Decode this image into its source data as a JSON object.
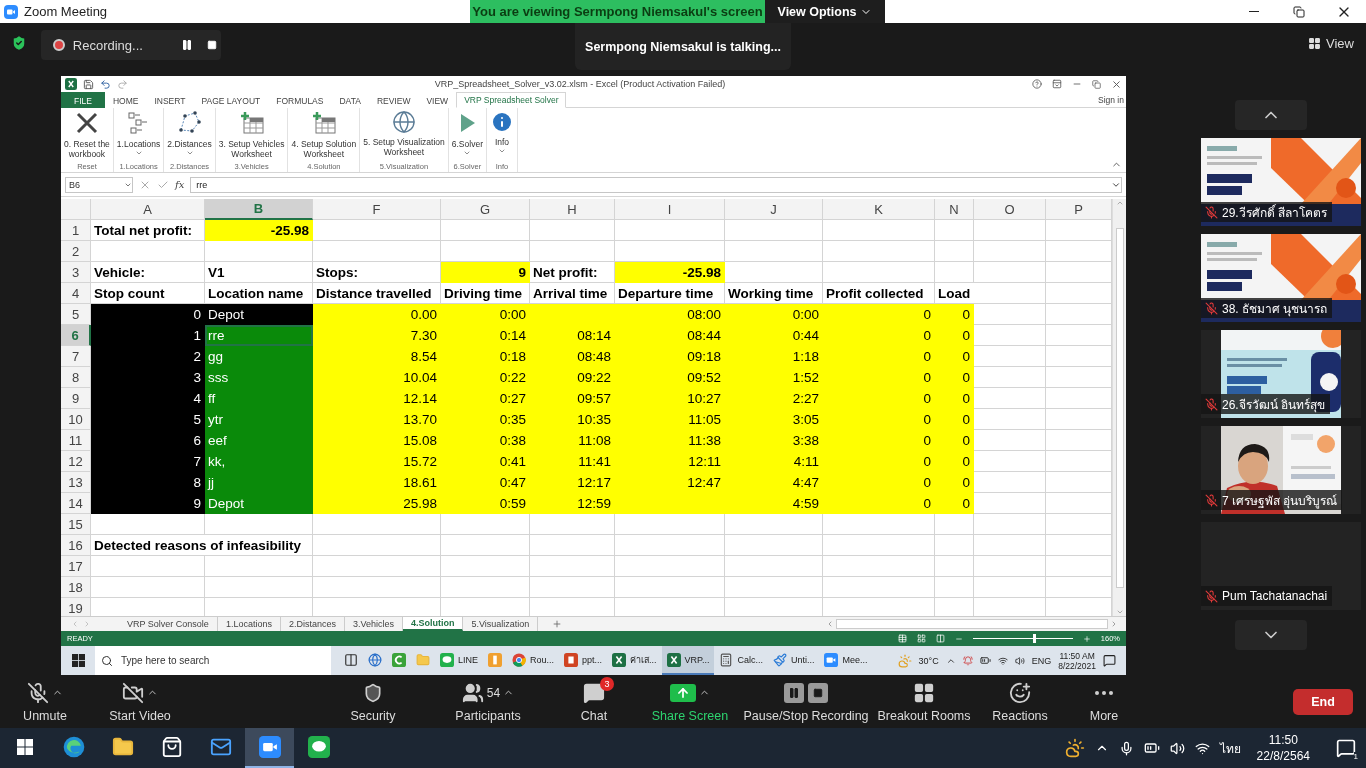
{
  "window": {
    "title": "Zoom Meeting"
  },
  "share_banner": {
    "text": "You are viewing Sermpong Niemsakul's screen",
    "button": "View Options"
  },
  "recording": {
    "label": "Recording..."
  },
  "toast": "Sermpong Niemsakul is talking...",
  "view_button": "View",
  "excel": {
    "title": "VRP_Spreadsheet_Solver_v3.02.xlsm - Excel (Product Activation Failed)",
    "sign_in": "Sign in",
    "ribbon_tabs": [
      {
        "label": "FILE",
        "kind": "file",
        "selected": false
      },
      {
        "label": "HOME",
        "kind": "tab",
        "selected": false
      },
      {
        "label": "INSERT",
        "kind": "tab",
        "selected": false
      },
      {
        "label": "PAGE LAYOUT",
        "kind": "tab",
        "selected": false
      },
      {
        "label": "FORMULAS",
        "kind": "tab",
        "selected": false
      },
      {
        "label": "DATA",
        "kind": "tab",
        "selected": false
      },
      {
        "label": "REVIEW",
        "kind": "tab",
        "selected": false
      },
      {
        "label": "VIEW",
        "kind": "tab",
        "selected": false
      },
      {
        "label": "VRP Spreadsheet Solver",
        "kind": "tab",
        "selected": true
      }
    ],
    "ribbon_groups": [
      {
        "group": "Reset",
        "kind": "reset",
        "lines": [
          "0. Reset the",
          "workbook"
        ],
        "dropdown": false
      },
      {
        "group": "1.Locations",
        "kind": "locations",
        "lines": [
          "1.Locations"
        ],
        "dropdown": true
      },
      {
        "group": "2.Distances",
        "kind": "distances",
        "lines": [
          "2.Distances"
        ],
        "dropdown": true
      },
      {
        "group": "3.Vehicles",
        "kind": "table",
        "lines": [
          "3. Setup Vehicles",
          "Worksheet"
        ],
        "dropdown": false
      },
      {
        "group": "4.Solution",
        "kind": "table",
        "lines": [
          "4. Setup Solution",
          "Worksheet"
        ],
        "dropdown": false
      },
      {
        "group": "5.Visualization",
        "kind": "globe",
        "lines": [
          "5. Setup Visualization",
          "Worksheet"
        ],
        "dropdown": false
      },
      {
        "group": "6.Solver",
        "kind": "solver",
        "lines": [
          "6.Solver"
        ],
        "dropdown": true
      },
      {
        "group": "Info",
        "kind": "info",
        "lines": [
          "Info"
        ],
        "dropdown": true
      }
    ],
    "name_box": "B6",
    "function_label": "fx",
    "formula": "rre",
    "columns": [
      {
        "label": "A",
        "selected": false
      },
      {
        "label": "B",
        "selected": true
      },
      {
        "label": "F",
        "selected": false
      },
      {
        "label": "G",
        "selected": false
      },
      {
        "label": "H",
        "selected": false
      },
      {
        "label": "I",
        "selected": false
      },
      {
        "label": "J",
        "selected": false
      },
      {
        "label": "K",
        "selected": false
      },
      {
        "label": "N",
        "selected": false
      },
      {
        "label": "O",
        "selected": false
      },
      {
        "label": "P",
        "selected": false
      }
    ],
    "rows": [
      {
        "n": "1",
        "bold": true,
        "selected": false,
        "cells": {
          "A": {
            "text": "Total net profit:",
            "kind": "text"
          },
          "B": {
            "text": "-25.98",
            "color": "#ffff00",
            "kind": "number"
          }
        }
      },
      {
        "n": "2",
        "selected": false
      },
      {
        "n": "3",
        "bold": true,
        "selected": false,
        "cells": {
          "A": {
            "text": "Vehicle:",
            "kind": "text"
          },
          "B": {
            "text": "V1",
            "kind": "text"
          },
          "F": {
            "text": "Stops:",
            "kind": "text"
          },
          "G": {
            "text": "9",
            "color": "#ffff00",
            "kind": "number"
          },
          "H": {
            "text": "Net profit:",
            "kind": "text"
          },
          "I": {
            "text": "-25.98",
            "color": "#ffff00",
            "kind": "number"
          }
        }
      },
      {
        "n": "4",
        "bold": true,
        "selected": false,
        "cells": {
          "A": {
            "text": "Stop count",
            "kind": "text"
          },
          "B": {
            "text": "Location name",
            "kind": "text"
          },
          "F": {
            "text": "Distance travelled",
            "kind": "text"
          },
          "G": {
            "text": "Driving time",
            "kind": "text"
          },
          "H": {
            "text": "Arrival time",
            "kind": "text"
          },
          "I": {
            "text": "Departure time",
            "kind": "text"
          },
          "J": {
            "text": "Working time",
            "kind": "text"
          },
          "K": {
            "text": "Profit collected",
            "kind": "text"
          },
          "N": {
            "text": "Load",
            "kind": "text"
          }
        }
      },
      {
        "n": "5",
        "bold": false,
        "selected": false,
        "cells": {
          "A": {
            "text": "0",
            "color": "#000000",
            "kind": "number"
          },
          "B": {
            "text": "Depot",
            "color": "#000000",
            "kind": "text"
          },
          "F": {
            "text": "0.00",
            "color": "#ffff00",
            "kind": "number"
          },
          "G": {
            "text": "0:00",
            "color": "#ffff00",
            "kind": "number"
          },
          "H": {
            "color": "#ffff00",
            "kind": "number"
          },
          "I": {
            "text": "08:00",
            "color": "#ffff00",
            "kind": "number"
          },
          "J": {
            "text": "0:00",
            "color": "#ffff00",
            "kind": "number"
          },
          "K": {
            "text": "0",
            "color": "#ffff00",
            "kind": "number"
          },
          "N": {
            "text": "0",
            "color": "#ffff00",
            "kind": "number"
          }
        }
      },
      {
        "n": "6",
        "bold": false,
        "selected": true,
        "cells": {
          "A": {
            "text": "1",
            "color": "#000000",
            "kind": "number"
          },
          "B": {
            "text": "rre",
            "color": "#0a8a0a",
            "kind": "text"
          },
          "F": {
            "text": "7.30",
            "color": "#ffff00",
            "kind": "number"
          },
          "G": {
            "text": "0:14",
            "color": "#ffff00",
            "kind": "number"
          },
          "H": {
            "text": "08:14",
            "color": "#ffff00",
            "kind": "number"
          },
          "I": {
            "text": "08:44",
            "color": "#ffff00",
            "kind": "number"
          },
          "J": {
            "text": "0:44",
            "color": "#ffff00",
            "kind": "number"
          },
          "K": {
            "text": "0",
            "color": "#ffff00",
            "kind": "number"
          },
          "N": {
            "text": "0",
            "color": "#ffff00",
            "kind": "number"
          }
        }
      },
      {
        "n": "7",
        "bold": false,
        "selected": false,
        "cells": {
          "A": {
            "text": "2",
            "color": "#000000",
            "kind": "number"
          },
          "B": {
            "text": "gg",
            "color": "#0a8a0a",
            "kind": "text"
          },
          "F": {
            "text": "8.54",
            "color": "#ffff00",
            "kind": "number"
          },
          "G": {
            "text": "0:18",
            "color": "#ffff00",
            "kind": "number"
          },
          "H": {
            "text": "08:48",
            "color": "#ffff00",
            "kind": "number"
          },
          "I": {
            "text": "09:18",
            "color": "#ffff00",
            "kind": "number"
          },
          "J": {
            "text": "1:18",
            "color": "#ffff00",
            "kind": "number"
          },
          "K": {
            "text": "0",
            "color": "#ffff00",
            "kind": "number"
          },
          "N": {
            "text": "0",
            "color": "#ffff00",
            "kind": "number"
          }
        }
      },
      {
        "n": "8",
        "bold": false,
        "selected": false,
        "cells": {
          "A": {
            "text": "3",
            "color": "#000000",
            "kind": "number"
          },
          "B": {
            "text": "sss",
            "color": "#0a8a0a",
            "kind": "text"
          },
          "F": {
            "text": "10.04",
            "color": "#ffff00",
            "kind": "number"
          },
          "G": {
            "text": "0:22",
            "color": "#ffff00",
            "kind": "number"
          },
          "H": {
            "text": "09:22",
            "color": "#ffff00",
            "kind": "number"
          },
          "I": {
            "text": "09:52",
            "color": "#ffff00",
            "kind": "number"
          },
          "J": {
            "text": "1:52",
            "color": "#ffff00",
            "kind": "number"
          },
          "K": {
            "text": "0",
            "color": "#ffff00",
            "kind": "number"
          },
          "N": {
            "text": "0",
            "color": "#ffff00",
            "kind": "number"
          }
        }
      },
      {
        "n": "9",
        "bold": false,
        "selected": false,
        "cells": {
          "A": {
            "text": "4",
            "color": "#000000",
            "kind": "number"
          },
          "B": {
            "text": "ff",
            "color": "#0a8a0a",
            "kind": "text"
          },
          "F": {
            "text": "12.14",
            "color": "#ffff00",
            "kind": "number"
          },
          "G": {
            "text": "0:27",
            "color": "#ffff00",
            "kind": "number"
          },
          "H": {
            "text": "09:57",
            "color": "#ffff00",
            "kind": "number"
          },
          "I": {
            "text": "10:27",
            "color": "#ffff00",
            "kind": "number"
          },
          "J": {
            "text": "2:27",
            "color": "#ffff00",
            "kind": "number"
          },
          "K": {
            "text": "0",
            "color": "#ffff00",
            "kind": "number"
          },
          "N": {
            "text": "0",
            "color": "#ffff00",
            "kind": "number"
          }
        }
      },
      {
        "n": "10",
        "bold": false,
        "selected": false,
        "cells": {
          "A": {
            "text": "5",
            "color": "#000000",
            "kind": "number"
          },
          "B": {
            "text": "ytr",
            "color": "#0a8a0a",
            "kind": "text"
          },
          "F": {
            "text": "13.70",
            "color": "#ffff00",
            "kind": "number"
          },
          "G": {
            "text": "0:35",
            "color": "#ffff00",
            "kind": "number"
          },
          "H": {
            "text": "10:35",
            "color": "#ffff00",
            "kind": "number"
          },
          "I": {
            "text": "11:05",
            "color": "#ffff00",
            "kind": "number"
          },
          "J": {
            "text": "3:05",
            "color": "#ffff00",
            "kind": "number"
          },
          "K": {
            "text": "0",
            "color": "#ffff00",
            "kind": "number"
          },
          "N": {
            "text": "0",
            "color": "#ffff00",
            "kind": "number"
          }
        }
      },
      {
        "n": "11",
        "bold": false,
        "selected": false,
        "cells": {
          "A": {
            "text": "6",
            "color": "#000000",
            "kind": "number"
          },
          "B": {
            "text": "eef",
            "color": "#0a8a0a",
            "kind": "text"
          },
          "F": {
            "text": "15.08",
            "color": "#ffff00",
            "kind": "number"
          },
          "G": {
            "text": "0:38",
            "color": "#ffff00",
            "kind": "number"
          },
          "H": {
            "text": "11:08",
            "color": "#ffff00",
            "kind": "number"
          },
          "I": {
            "text": "11:38",
            "color": "#ffff00",
            "kind": "number"
          },
          "J": {
            "text": "3:38",
            "color": "#ffff00",
            "kind": "number"
          },
          "K": {
            "text": "0",
            "color": "#ffff00",
            "kind": "number"
          },
          "N": {
            "text": "0",
            "color": "#ffff00",
            "kind": "number"
          }
        }
      },
      {
        "n": "12",
        "bold": false,
        "selected": false,
        "cells": {
          "A": {
            "text": "7",
            "color": "#000000",
            "kind": "number"
          },
          "B": {
            "text": "kk,",
            "color": "#0a8a0a",
            "kind": "text"
          },
          "F": {
            "text": "15.72",
            "color": "#ffff00",
            "kind": "number"
          },
          "G": {
            "text": "0:41",
            "color": "#ffff00",
            "kind": "number"
          },
          "H": {
            "text": "11:41",
            "color": "#ffff00",
            "kind": "number"
          },
          "I": {
            "text": "12:11",
            "color": "#ffff00",
            "kind": "number"
          },
          "J": {
            "text": "4:11",
            "color": "#ffff00",
            "kind": "number"
          },
          "K": {
            "text": "0",
            "color": "#ffff00",
            "kind": "number"
          },
          "N": {
            "text": "0",
            "color": "#ffff00",
            "kind": "number"
          }
        }
      },
      {
        "n": "13",
        "bold": false,
        "selected": false,
        "cells": {
          "A": {
            "text": "8",
            "color": "#000000",
            "kind": "number"
          },
          "B": {
            "text": "jj",
            "color": "#0a8a0a",
            "kind": "text"
          },
          "F": {
            "text": "18.61",
            "color": "#ffff00",
            "kind": "number"
          },
          "G": {
            "text": "0:47",
            "color": "#ffff00",
            "kind": "number"
          },
          "H": {
            "text": "12:17",
            "color": "#ffff00",
            "kind": "number"
          },
          "I": {
            "text": "12:47",
            "color": "#ffff00",
            "kind": "number"
          },
          "J": {
            "text": "4:47",
            "color": "#ffff00",
            "kind": "number"
          },
          "K": {
            "text": "0",
            "color": "#ffff00",
            "kind": "number"
          },
          "N": {
            "text": "0",
            "color": "#ffff00",
            "kind": "number"
          }
        }
      },
      {
        "n": "14",
        "bold": false,
        "selected": false,
        "cells": {
          "A": {
            "text": "9",
            "color": "#000000",
            "kind": "number"
          },
          "B": {
            "text": "Depot",
            "color": "#0a8a0a",
            "kind": "text"
          },
          "F": {
            "text": "25.98",
            "color": "#ffff00",
            "kind": "number"
          },
          "G": {
            "text": "0:59",
            "color": "#ffff00",
            "kind": "number"
          },
          "H": {
            "text": "12:59",
            "color": "#ffff00",
            "kind": "number"
          },
          "I": {
            "color": "#ffff00",
            "kind": "number"
          },
          "J": {
            "text": "4:59",
            "color": "#ffff00",
            "kind": "number"
          },
          "K": {
            "text": "0",
            "color": "#ffff00",
            "kind": "number"
          },
          "N": {
            "text": "0",
            "color": "#ffff00",
            "kind": "number"
          }
        }
      },
      {
        "n": "15",
        "selected": false
      },
      {
        "n": "16",
        "bold": true,
        "selected": false,
        "cells": {
          "A": {
            "text": "Detected reasons of infeasibility",
            "kind": "text"
          }
        }
      },
      {
        "n": "17",
        "selected": false
      },
      {
        "n": "18",
        "selected": false
      },
      {
        "n": "19",
        "selected": false
      }
    ],
    "sheet_tabs": [
      {
        "label": "VRP Solver Console",
        "selected": false
      },
      {
        "label": "1.Locations",
        "selected": false
      },
      {
        "label": "2.Distances",
        "selected": false
      },
      {
        "label": "3.Vehicles",
        "selected": false
      },
      {
        "label": "4.Solution",
        "selected": true
      },
      {
        "label": "5.Visualization",
        "selected": false
      }
    ],
    "status": "READY",
    "zoom": {
      "level": 0.6,
      "label": "160%"
    }
  },
  "inner_taskbar": {
    "search_placeholder": "Type here to search",
    "apps": [
      {
        "kind": "task-view",
        "active": false
      },
      {
        "kind": "globe",
        "active": false
      },
      {
        "kind": "camtasia",
        "active": false
      },
      {
        "kind": "folder",
        "active": false
      },
      {
        "kind": "line",
        "label": "LINE",
        "active": false
      },
      {
        "kind": "app",
        "active": false
      },
      {
        "kind": "chrome",
        "label": "Rou...",
        "active": false
      },
      {
        "kind": "powerpoint",
        "label": "ppt...",
        "active": false
      },
      {
        "kind": "excel",
        "label": "ค่าเส...",
        "active": false
      },
      {
        "kind": "excel",
        "label": "VRP...",
        "active": true
      },
      {
        "kind": "calculator",
        "label": "Calc...",
        "active": false
      },
      {
        "kind": "paint",
        "label": "Unti...",
        "active": false
      },
      {
        "kind": "zoom",
        "label": "Mee...",
        "active": false
      }
    ],
    "weather": "30°C",
    "lang": "ENG",
    "time": "11:50 AM",
    "date": "8/22/2021"
  },
  "participants": [
    {
      "name": "29.วีรศักดิ์ สีลาโคตร",
      "kind": "banner"
    },
    {
      "name": "38. ธัชมาศ นุชนารถ",
      "kind": "banner"
    },
    {
      "name": "26.จีรวัฒน์ อินทร์สุข",
      "kind": "slide"
    },
    {
      "name": "7 เศรษฐพัส อุ่นบริบูรณ์",
      "kind": "camera"
    },
    {
      "name": "Pum Tachatanachai",
      "kind": "empty"
    }
  ],
  "toolbar": [
    {
      "label": "Unmute",
      "kind": "mic-off",
      "caret": true
    },
    {
      "label": "Start Video",
      "kind": "video-off",
      "caret": true
    },
    {
      "label": "Security",
      "kind": "security",
      "caret": false
    },
    {
      "label": "Participants",
      "kind": "participants",
      "count": "54",
      "caret": true
    },
    {
      "label": "Chat",
      "kind": "chat",
      "badge": "3",
      "caret": false
    },
    {
      "label": "Share Screen",
      "kind": "share",
      "caret": true
    },
    {
      "label": "Pause/Stop Recording",
      "kind": "recording",
      "caret": false
    },
    {
      "label": "Breakout Rooms",
      "kind": "breakout",
      "caret": false
    },
    {
      "label": "Reactions",
      "kind": "reactions",
      "caret": false
    },
    {
      "label": "More",
      "kind": "more",
      "caret": false
    }
  ],
  "end_button": "End",
  "taskbar": {
    "apps": [
      {
        "kind": "edge",
        "active": false
      },
      {
        "kind": "folder",
        "active": false
      },
      {
        "kind": "store",
        "active": false
      },
      {
        "kind": "mail",
        "active": false
      },
      {
        "kind": "zoom",
        "active": true
      },
      {
        "kind": "line",
        "active": false
      }
    ],
    "lang": "ไทย",
    "time": "11:50",
    "date": "22/8/2564",
    "notifications": "1"
  }
}
